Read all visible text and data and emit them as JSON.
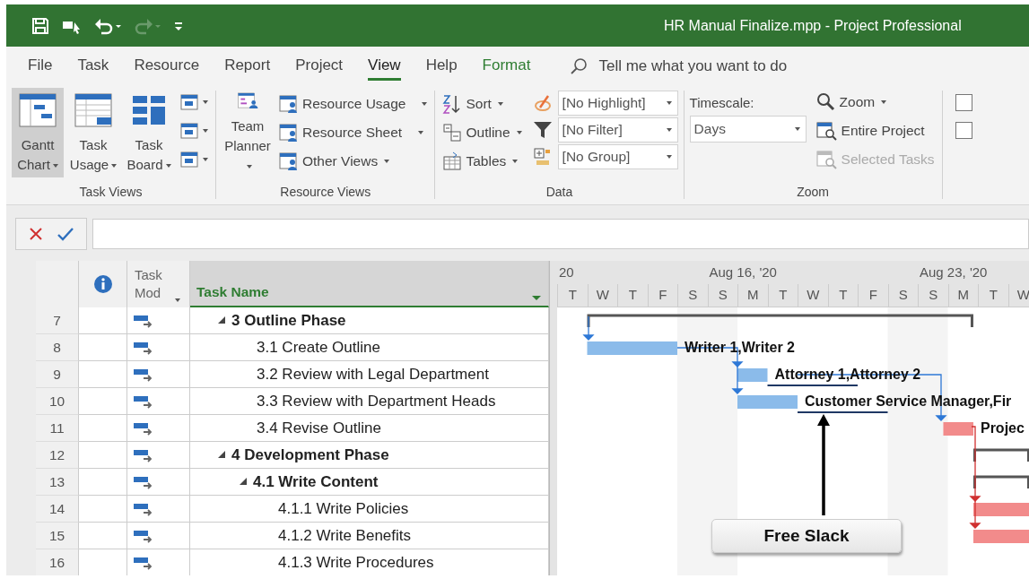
{
  "title_bar": {
    "title": "HR Manual Finalize.mpp  -  Project Professional",
    "quick_access": [
      {
        "kind": "save",
        "disabled": false
      },
      {
        "kind": "touch",
        "disabled": false
      },
      {
        "kind": "undo",
        "disabled": false
      },
      {
        "kind": "redo",
        "disabled": true
      },
      {
        "kind": "customize",
        "disabled": false
      }
    ]
  },
  "menu_tabs": [
    {
      "label": "File",
      "selected": false,
      "kind": "normal"
    },
    {
      "label": "Task",
      "selected": false,
      "kind": "normal"
    },
    {
      "label": "Resource",
      "selected": false,
      "kind": "normal"
    },
    {
      "label": "Report",
      "selected": false,
      "kind": "normal"
    },
    {
      "label": "Project",
      "selected": false,
      "kind": "normal"
    },
    {
      "label": "View",
      "selected": true,
      "kind": "normal"
    },
    {
      "label": "Help",
      "selected": false,
      "kind": "normal"
    },
    {
      "label": "Format",
      "selected": false,
      "kind": "contextual"
    }
  ],
  "tell_me": {
    "placeholder": "Tell me what you want to do"
  },
  "ribbon": {
    "task_views": {
      "label": "Task Views",
      "buttons": [
        {
          "label": "Gantt Chart",
          "selected": true
        },
        {
          "label": "Task Usage",
          "selected": false
        },
        {
          "label": "Task Board",
          "selected": false
        }
      ]
    },
    "resource_views": {
      "label": "Resource Views",
      "large_button": "Team Planner",
      "items": [
        "Resource Usage",
        "Resource Sheet",
        "Other Views"
      ]
    },
    "data": {
      "label": "Data",
      "commands": [
        "Sort",
        "Outline",
        "Tables"
      ],
      "dropdowns": [
        "[No Highlight]",
        "[No Filter]",
        "[No Group]"
      ]
    },
    "zoom": {
      "label": "Zoom",
      "timescale_label": "Timescale:",
      "timescale_value": "Days",
      "commands": [
        {
          "label": "Zoom",
          "disabled": false
        },
        {
          "label": "Entire Project",
          "disabled": false
        },
        {
          "label": "Selected Tasks",
          "disabled": true
        }
      ]
    },
    "checkboxes": [
      {
        "checked": false
      },
      {
        "checked": false
      }
    ]
  },
  "table": {
    "columns": [
      {
        "kind": "info"
      },
      {
        "kind": "mode",
        "label": "Task Mod"
      },
      {
        "kind": "name",
        "label": "Task Name"
      }
    ]
  },
  "timescale": {
    "weeks": [
      "20",
      "Aug 16, '20",
      "Aug 23, '20"
    ],
    "days": [
      "T",
      "W",
      "T",
      "F",
      "S",
      "S",
      "M",
      "T",
      "W",
      "T",
      "F",
      "S",
      "S",
      "M",
      "T",
      "W"
    ]
  },
  "tasks": [
    {
      "id": "7",
      "name": "3 Outline Phase",
      "expanded": true,
      "bar": {
        "kind": "summary"
      },
      "children": [
        {
          "id": "8",
          "name": "3.1 Create Outline",
          "bar": {
            "kind": "task",
            "label": "Writer 1,Writer 2"
          }
        },
        {
          "id": "9",
          "name": "3.2 Review with Legal Department",
          "bar": {
            "kind": "task",
            "label": "Attorney 1,Attorney 2"
          }
        },
        {
          "id": "10",
          "name": "3.3 Review with Department Heads",
          "bar": {
            "kind": "task",
            "label": "Customer Service Manager,Fir"
          }
        },
        {
          "id": "11",
          "name": "3.4 Revise Outline",
          "bar": {
            "kind": "critical",
            "label": "Projec"
          }
        }
      ]
    },
    {
      "id": "12",
      "name": "4 Development Phase",
      "expanded": true,
      "bar": {
        "kind": "summary"
      },
      "children": [
        {
          "id": "13",
          "name": "4.1 Write Content",
          "expanded": true,
          "bar": {
            "kind": "summary"
          },
          "children": [
            {
              "id": "14",
              "name": "4.1.1 Write Policies",
              "bar": {
                "kind": "critical"
              }
            },
            {
              "id": "15",
              "name": "4.1.2 Write Benefits",
              "bar": {
                "kind": "critical"
              }
            },
            {
              "id": "16",
              "name": "4.1.3 Write Procedures"
            }
          ]
        }
      ]
    }
  ],
  "callout": {
    "text": "Free Slack"
  }
}
